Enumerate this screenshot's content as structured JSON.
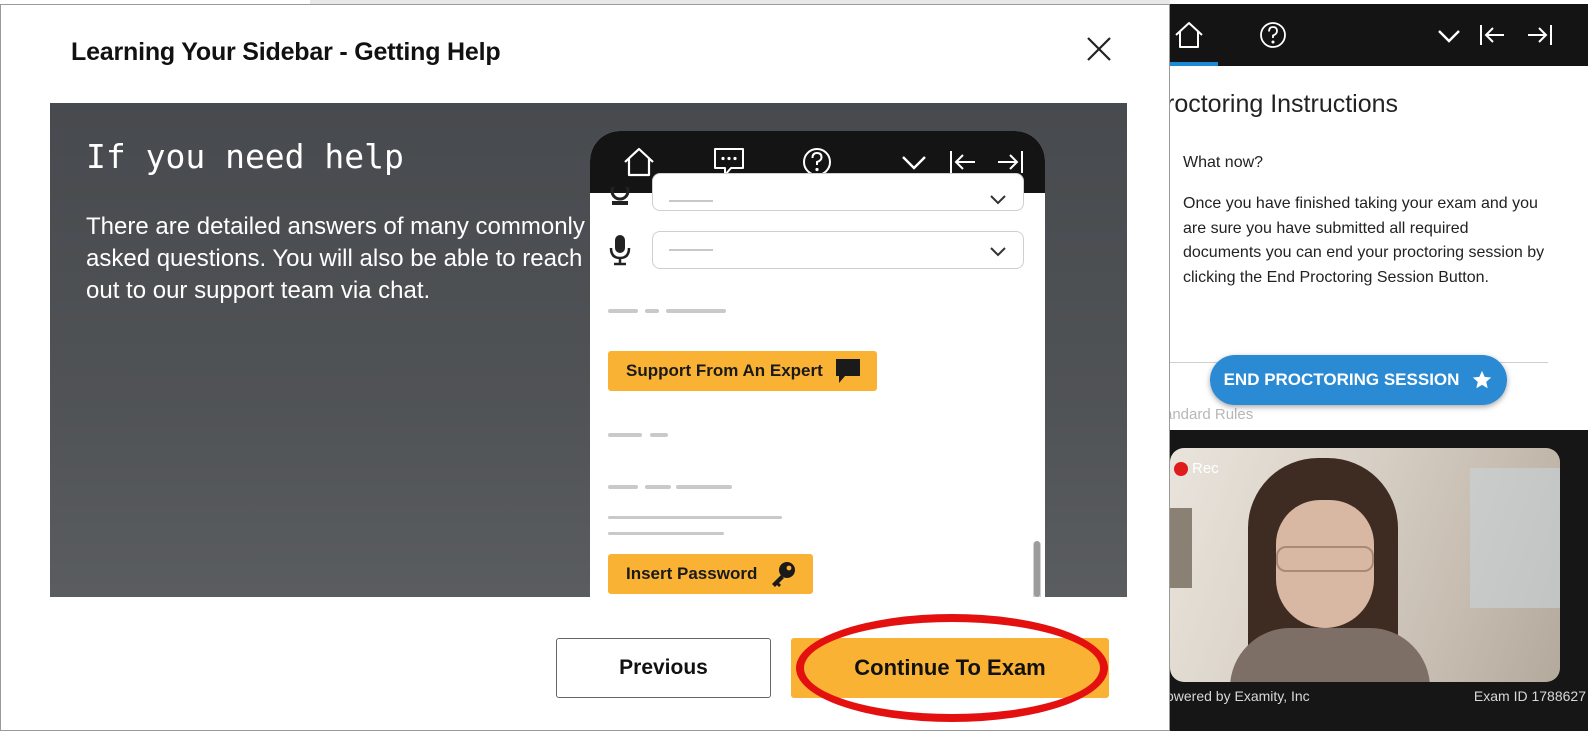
{
  "modal": {
    "title": "Learning Your Sidebar - Getting Help",
    "close_icon": "close-icon",
    "banner": {
      "heading": "If you need help",
      "text": "There are detailed answers of many commonly asked questions. You will also be able to reach out to our support team via chat."
    },
    "mockup": {
      "nav_icons": [
        "home-icon",
        "chat-icon",
        "help-icon",
        "chevron-down-icon",
        "collapse-left-icon",
        "expand-right-icon"
      ],
      "support_button_label": "Support From An Expert",
      "support_button_icon": "chat-bubble-icon",
      "password_button_label": "Insert Password",
      "password_button_icon": "key-icon"
    },
    "buttons": {
      "previous": "Previous",
      "continue": "Continue To Exam"
    },
    "colors": {
      "accent": "#f9b233",
      "banner_bg": "#4d5054",
      "highlight_ring": "#e41010",
      "nav_active": "#1e88d8"
    }
  },
  "sidebar": {
    "nav_icons": [
      "home-icon",
      "help-icon",
      "chevron-down-icon",
      "collapse-left-icon",
      "expand-right-icon"
    ],
    "title": "roctoring Instructions",
    "question": "What now?",
    "description": "Once you have finished taking your exam and you are sure you have submitted all required documents you can end your proctoring session by clicking the End Proctoring Session Button.",
    "end_button_label": "END PROCTORING SESSION",
    "end_button_icon": "star-icon",
    "standard_rules_label": "andard Rules",
    "video": {
      "rec_label": "Rec"
    },
    "footer_left": "owered by Examity, Inc",
    "footer_right": "Exam ID 1788627",
    "colors": {
      "button": "#2a8bd4",
      "nav_bg": "#141414"
    }
  }
}
